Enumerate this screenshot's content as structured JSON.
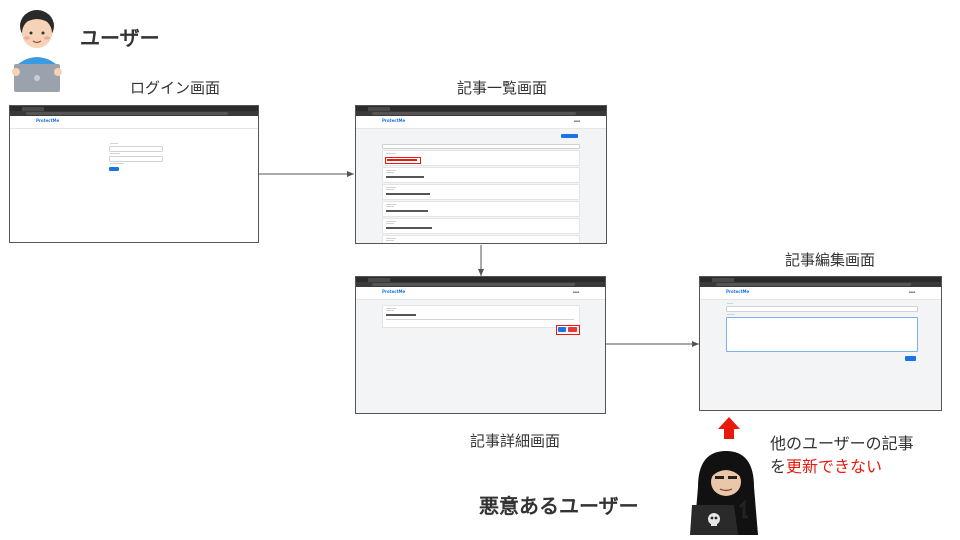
{
  "user_label": "ユーザー",
  "malicious_label": "悪意あるユーザー",
  "screens": {
    "login": {
      "title": "ログイン画面",
      "brand": "ProtectMe"
    },
    "list": {
      "title": "記事一覧画面",
      "brand": "ProtectMe"
    },
    "detail": {
      "title": "記事詳細画面",
      "brand": "ProtectMe"
    },
    "edit": {
      "title": "記事編集画面",
      "brand": "ProtectMe"
    }
  },
  "note": {
    "line1": "他のユーザーの記事",
    "line2_prefix": "を",
    "line2_highlight": "更新できない"
  },
  "colors": {
    "highlight_red": "#e8190d",
    "arrow_red": "#e8190d",
    "connector": "#555555",
    "brand_blue": "#1a73e8"
  }
}
